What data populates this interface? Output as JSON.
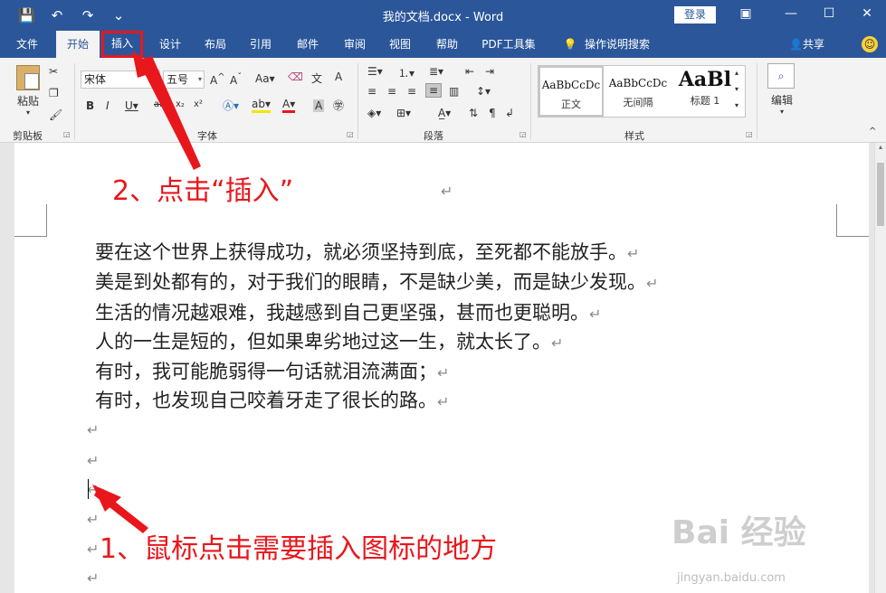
{
  "titlebar": {
    "title": "我的文档.docx  -  Word",
    "login": "登录",
    "qat": [
      "💾",
      "↶",
      "↷",
      "⌄"
    ]
  },
  "tabs": [
    "文件",
    "开始",
    "插入",
    "设计",
    "布局",
    "引用",
    "邮件",
    "审阅",
    "视图",
    "帮助",
    "PDF工具集",
    "操作说明搜索"
  ],
  "share": "共享",
  "ribbon": {
    "clipboard": {
      "label": "剪贴板",
      "paste": "粘贴"
    },
    "font": {
      "label": "字体",
      "name": "宋体",
      "size": "五号"
    },
    "paragraph": {
      "label": "段落"
    },
    "styles": {
      "label": "样式",
      "items": [
        {
          "sample": "AaBbCcDc",
          "name": "正文"
        },
        {
          "sample": "AaBbCcDc",
          "name": "无间隔"
        },
        {
          "sample": "AaBl",
          "name": "标题 1"
        }
      ]
    },
    "editing": {
      "label": "编辑"
    }
  },
  "document": {
    "lines": [
      "要在这个世界上获得成功，就必须坚持到底，至死都不能放手。",
      "美是到处都有的，对于我们的眼睛，不是缺少美，而是缺少发现。",
      "生活的情况越艰难，我越感到自己更坚强，甚而也更聪明。",
      "人的一生是短的，但如果卑劣地过这一生，就太长了。",
      "有时，我可能脆弱得一句话就泪流满面；",
      "有时，也发现自己咬着牙走了很长的路。"
    ],
    "mark": "↵"
  },
  "annotations": {
    "step2": "2、点击“插入”",
    "step1": "1、鼠标点击需要插入图标的地方"
  },
  "watermark": {
    "main": "Bai 经验",
    "sub": "jingyan.baidu.com"
  },
  "colors": {
    "accent": "#2b579a",
    "annotation": "#e8171c"
  }
}
